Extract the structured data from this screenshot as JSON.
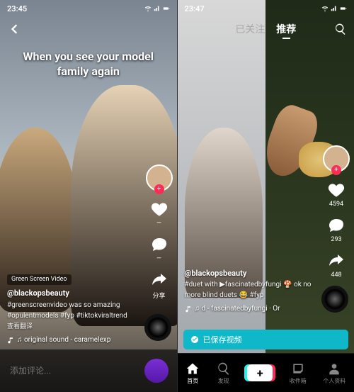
{
  "left": {
    "status_time": "23:45",
    "overlay_text": "When you see your model family again",
    "tag_label": "Green Screen Video",
    "username": "@blackopsbeauty",
    "description": "#greenscreenvideo was so amazing #opulentmodels #fyp #tiktokviraltrend",
    "translate_hint": "查看翻译",
    "music": "♫ original sound - caramelexp",
    "like_count": "—",
    "comment_count": "—",
    "share_label": "分享",
    "comment_placeholder": "添加评论..."
  },
  "right": {
    "status_time": "23:47",
    "tabs": {
      "following": "已关注",
      "recommend": "推荐"
    },
    "username": "@blackopsbeauty",
    "description": "#duet with ▶fascinatedbyfungi 🍄 ok no more blind duets 😂 #fyp",
    "music": "♫ d - fascinatedbyfungi · Or",
    "like_count": "4594",
    "comment_count": "293",
    "share_count": "448",
    "saved_banner": "已保存视频",
    "nav": {
      "home": "首页",
      "discover": "发现",
      "inbox": "收件箱",
      "profile": "个人资料"
    }
  }
}
